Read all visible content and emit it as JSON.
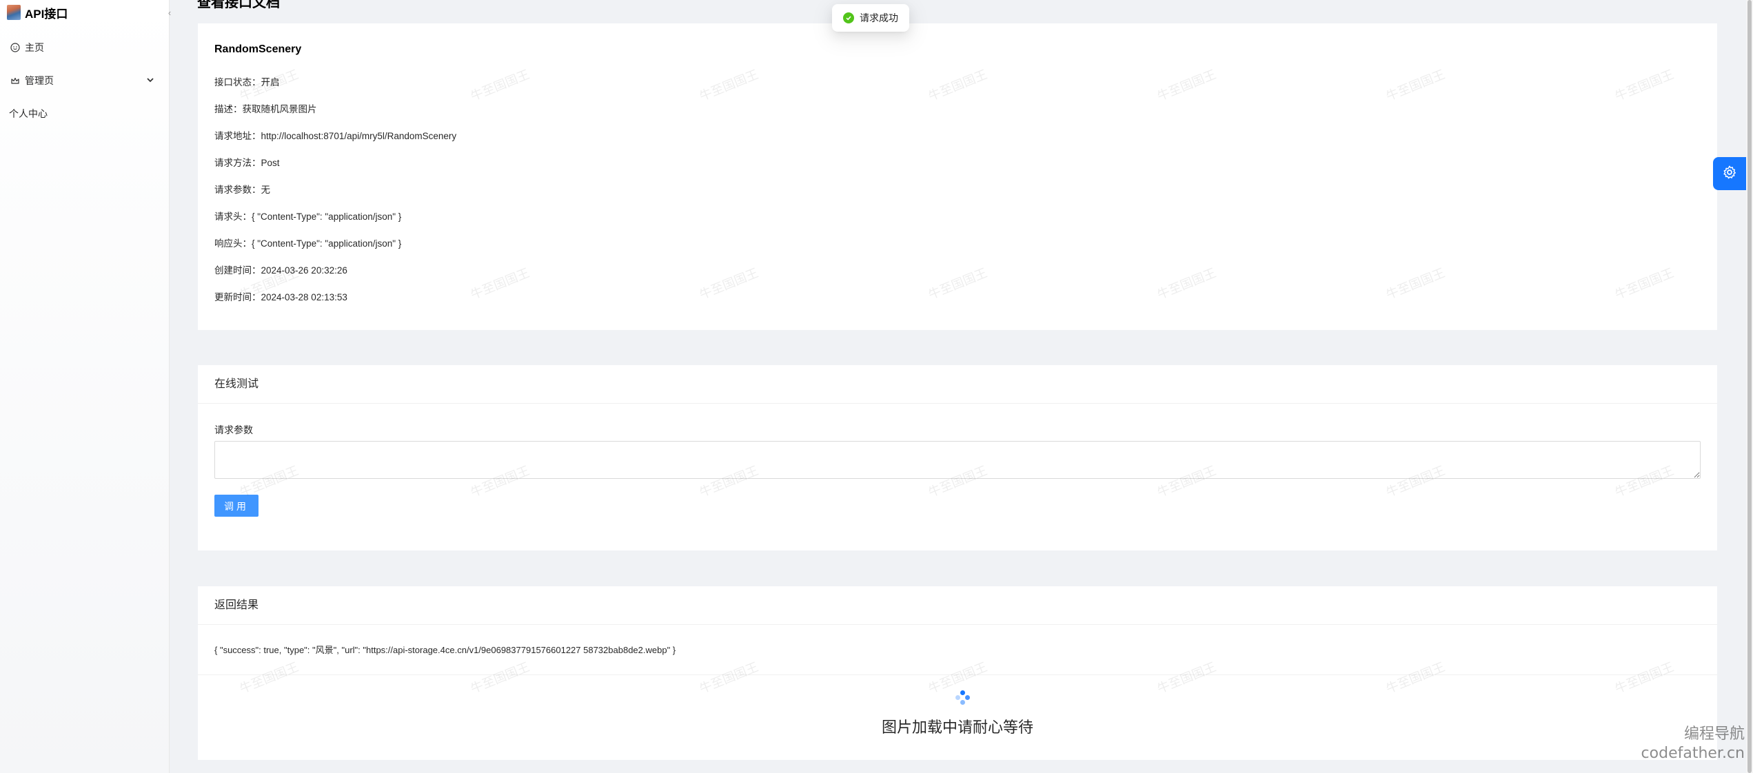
{
  "app": {
    "title": "API接口"
  },
  "sidebar": {
    "items": [
      {
        "label": "主页",
        "icon": "smile-icon"
      },
      {
        "label": "管理页",
        "icon": "crown-icon",
        "expandable": true
      },
      {
        "label": "个人中心"
      }
    ]
  },
  "page": {
    "title": "查看接口文档"
  },
  "toast": {
    "message": "请求成功",
    "status_color": "#52c41a"
  },
  "doc": {
    "name": "RandomScenery",
    "rows": [
      {
        "label": "接口状态：",
        "value": "开启"
      },
      {
        "label": "描述：",
        "value": "获取随机风景图片"
      },
      {
        "label": "请求地址：",
        "value": "http://localhost:8701/api/mry5l/RandomScenery"
      },
      {
        "label": "请求方法：",
        "value": "Post"
      },
      {
        "label": "请求参数：",
        "value": "无"
      },
      {
        "label": "请求头：",
        "value": "{ \"Content-Type\": \"application/json\" }"
      },
      {
        "label": "响应头：",
        "value": "{ \"Content-Type\": \"application/json\" }"
      },
      {
        "label": "创建时间：",
        "value": "2024-03-26 20:32:26"
      },
      {
        "label": "更新时间：",
        "value": "2024-03-28 02:13:53"
      }
    ]
  },
  "test": {
    "title": "在线测试",
    "param_label": "请求参数",
    "param_value": "",
    "invoke_label": "调用"
  },
  "result": {
    "title": "返回结果",
    "json": "{ \"success\": true, \"type\": \"风景\", \"url\": \"https://api-storage.4ce.cn/v1/9e069837791576601227 58732bab8de2.webp\" }",
    "loading_text": "图片加载中请耐心等待"
  },
  "watermark": {
    "text": "牛至国国王"
  },
  "corner_watermark": {
    "line1": "编程导航",
    "line2": "codefather.cn"
  },
  "colors": {
    "primary": "#1677ff",
    "button": "#4096ff",
    "success": "#52c41a"
  }
}
